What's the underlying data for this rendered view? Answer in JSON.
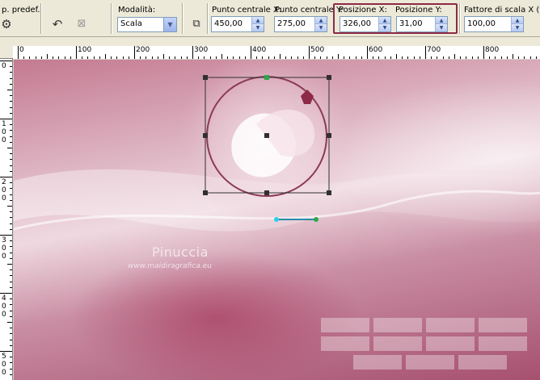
{
  "toolbar": {
    "preset": {
      "label": "p. predef.:"
    },
    "mode": {
      "label": "Modalità:",
      "value": "Scala"
    },
    "center_x": {
      "label": "Punto centrale X:",
      "value": "450,00"
    },
    "center_y": {
      "label": "Punto centrale Y:",
      "value": "275,00"
    },
    "pos_x": {
      "label": "Posizione X:",
      "value": "326,00"
    },
    "pos_y": {
      "label": "Posizione Y:",
      "value": "31,00"
    },
    "scale_x": {
      "label": "Fattore di scala X (%):",
      "value": "100,00"
    }
  },
  "ruler": {
    "top_labels": [
      "0",
      "100",
      "200",
      "300",
      "400",
      "500",
      "600",
      "700",
      "800"
    ],
    "left_labels": [
      "0",
      "100",
      "200",
      "300",
      "400",
      "500"
    ]
  },
  "canvas": {
    "watermark_name": "Pinuccia",
    "watermark_url": "www.maidiragrafica.eu"
  },
  "colors": {
    "highlight_box": "#8d2a45",
    "canvas_base": "#c98ea3",
    "node_green": "#2aa84a",
    "handle_cyan": "#2ad0e6"
  }
}
